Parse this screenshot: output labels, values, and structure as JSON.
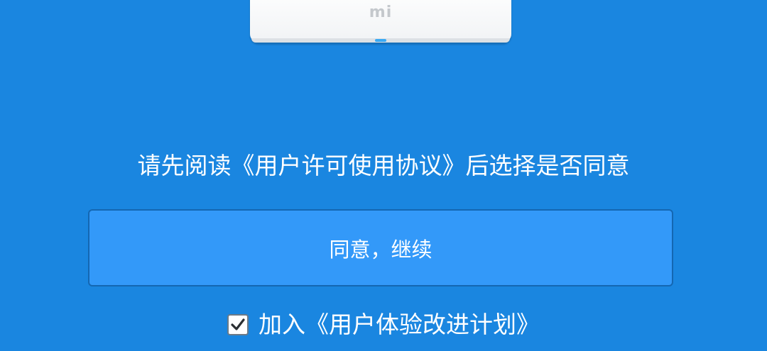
{
  "router": {
    "logo_text": "mi",
    "icon": "router-icon"
  },
  "notice": {
    "text": "请先阅读《用户许可使用协议》后选择是否同意"
  },
  "agree_button": {
    "label": "同意，继续",
    "color": "#3399f9"
  },
  "ux_program": {
    "checked": true,
    "label": "加入《用户体验改进计划》"
  },
  "colors": {
    "background": "#1a86e0",
    "button": "#3399f9",
    "text": "#ffffff"
  }
}
